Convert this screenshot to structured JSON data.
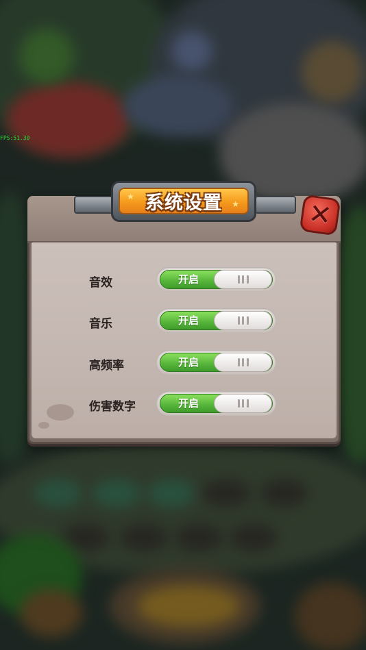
{
  "debug": {
    "fps": "FPS:51.30"
  },
  "dialog": {
    "title": "系统设置",
    "close_symbol": "✕",
    "settings": [
      {
        "label": "音效",
        "state_label": "开启",
        "enabled": true
      },
      {
        "label": "音乐",
        "state_label": "开启",
        "enabled": true
      },
      {
        "label": "高频率",
        "state_label": "开启",
        "enabled": true
      },
      {
        "label": "伤害数字",
        "state_label": "开启",
        "enabled": true
      }
    ]
  },
  "colors": {
    "toggle_on": "#55b43a",
    "title_plaque": "#f59a1c",
    "close_button": "#c72e25",
    "panel_body": "#c3b6b0"
  },
  "icons": [
    "close-icon",
    "toggle-grip-icon",
    "star-icon"
  ]
}
